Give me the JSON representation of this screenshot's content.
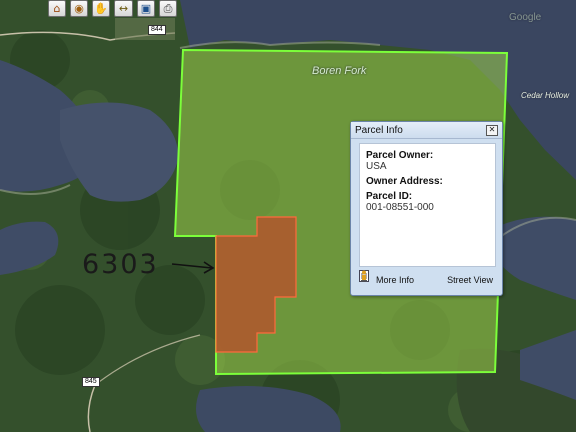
{
  "toolbar": {
    "buttons": [
      {
        "name": "home",
        "icon": "home-icon",
        "glyph": "⌂"
      },
      {
        "name": "layers",
        "icon": "layers-icon",
        "glyph": "◉"
      },
      {
        "name": "pan",
        "icon": "pan-hand-icon",
        "glyph": "✋"
      },
      {
        "name": "measure",
        "icon": "measure-icon",
        "glyph": "↔"
      },
      {
        "name": "identify",
        "icon": "identify-icon",
        "glyph": "▣"
      },
      {
        "name": "print",
        "icon": "print-icon",
        "glyph": "⎙"
      }
    ]
  },
  "map": {
    "labels": {
      "water_body": "Boren Fork",
      "place": "Cedar Hollow",
      "watermark": "Google"
    },
    "highways": [
      "844",
      "845"
    ],
    "annotation": "6303",
    "colors": {
      "parcel_highlight": "#9cd04a",
      "parcel_outline": "#7cff3a",
      "selected_parcel": "#b5532c",
      "water": "#3d4a63",
      "forest": "#2f4a26"
    }
  },
  "popup": {
    "title": "Parcel Info",
    "close_glyph": "✕",
    "fields": [
      {
        "label": "Parcel Owner:",
        "value": "USA"
      },
      {
        "label": "Owner Address:",
        "value": ""
      },
      {
        "label": "Parcel ID:",
        "value": "001-08551-000"
      }
    ],
    "actions": {
      "more_info": "More Info",
      "street_view": "Street View"
    }
  }
}
